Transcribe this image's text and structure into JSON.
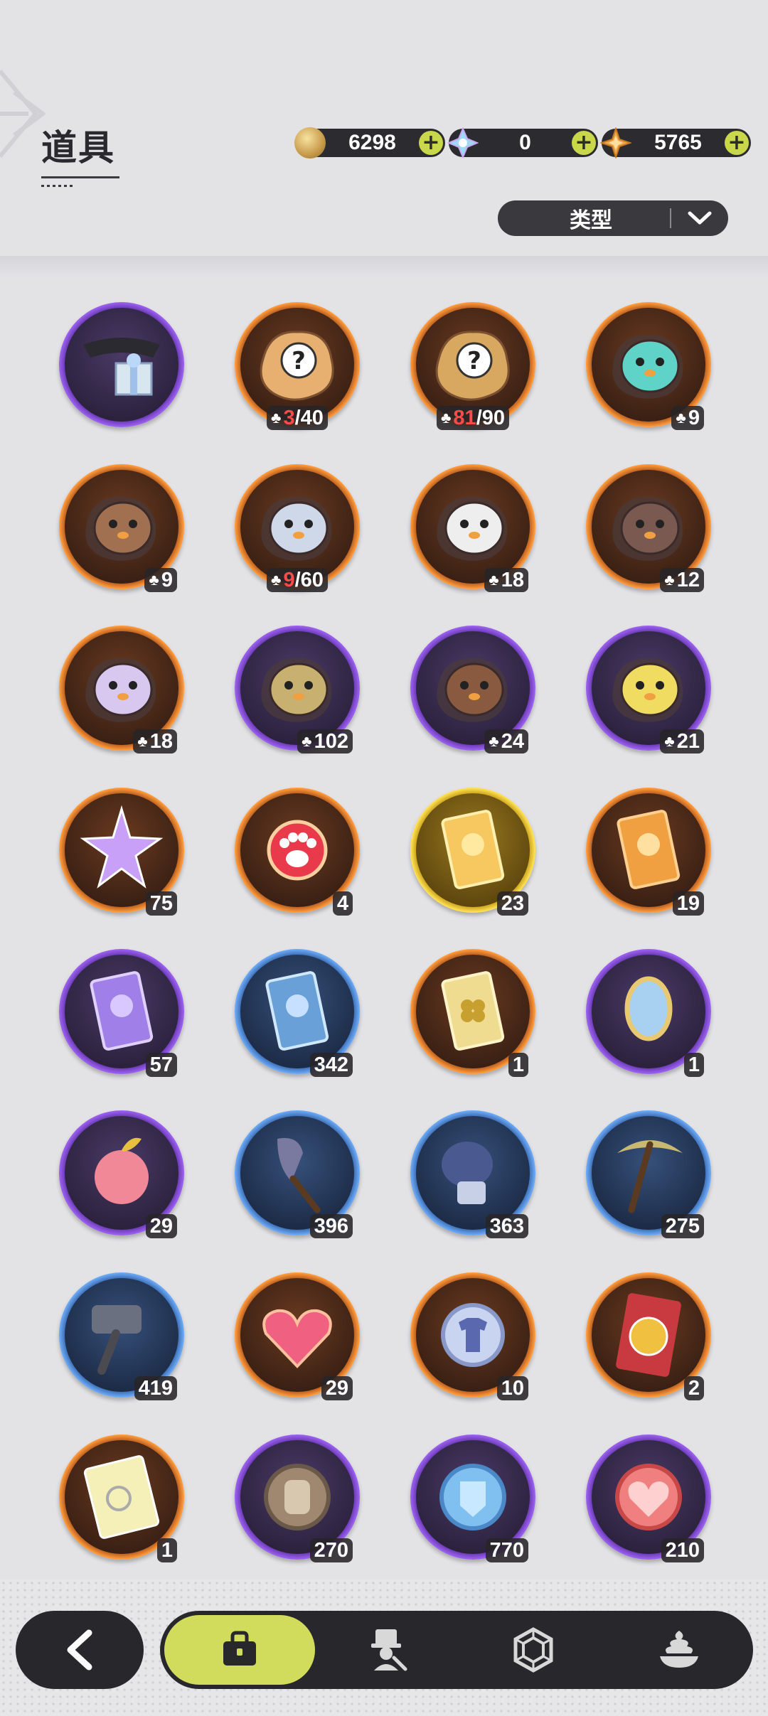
{
  "header": {
    "title": "道具"
  },
  "currencies": [
    {
      "icon": "gold-coin-icon",
      "value": "6298"
    },
    {
      "icon": "crystal-icon",
      "value": "0"
    },
    {
      "icon": "star-gem-icon",
      "value": "5765"
    }
  ],
  "filter": {
    "label": "类型",
    "icon": "chevron-down-icon"
  },
  "items": [
    {
      "name": "gift-box-item",
      "rarity": "purple",
      "count": ""
    },
    {
      "name": "random-fragment-orange",
      "rarity": "orange",
      "fragment": true,
      "have": "3",
      "need": "/40"
    },
    {
      "name": "random-fragment-gold",
      "rarity": "orange",
      "fragment": true,
      "have": "81",
      "need": "/90"
    },
    {
      "name": "teal-bird-fragment",
      "rarity": "orange",
      "fragment": true,
      "count": "9"
    },
    {
      "name": "bear-fragment",
      "rarity": "orange",
      "fragment": true,
      "count": "9"
    },
    {
      "name": "knight-fragment",
      "rarity": "orange",
      "fragment": true,
      "have": "9",
      "need": "/60"
    },
    {
      "name": "white-creature-fragment",
      "rarity": "orange",
      "fragment": true,
      "count": "18"
    },
    {
      "name": "dark-bear-fragment",
      "rarity": "orange",
      "fragment": true,
      "count": "12"
    },
    {
      "name": "lilac-creature-fragment",
      "rarity": "orange",
      "fragment": true,
      "count": "18"
    },
    {
      "name": "frog-fragment",
      "rarity": "purple",
      "fragment": true,
      "count": "102"
    },
    {
      "name": "brown-bear-fragment",
      "rarity": "purple",
      "fragment": true,
      "count": "24"
    },
    {
      "name": "yellow-chick-fragment",
      "rarity": "purple",
      "fragment": true,
      "count": "21"
    },
    {
      "name": "star-crystal",
      "rarity": "orange",
      "count": "75"
    },
    {
      "name": "paw-charm",
      "rarity": "orange",
      "count": "4"
    },
    {
      "name": "gold-card",
      "rarity": "gold",
      "count": "23"
    },
    {
      "name": "orange-card",
      "rarity": "orange",
      "count": "19"
    },
    {
      "name": "purple-card",
      "rarity": "purple",
      "count": "57"
    },
    {
      "name": "blue-card",
      "rarity": "blue",
      "count": "342"
    },
    {
      "name": "clover-card",
      "rarity": "orange",
      "count": "1"
    },
    {
      "name": "magic-mirror",
      "rarity": "purple",
      "count": "1"
    },
    {
      "name": "pink-apple",
      "rarity": "purple",
      "count": "29"
    },
    {
      "name": "shovel",
      "rarity": "blue",
      "count": "396"
    },
    {
      "name": "gauntlet",
      "rarity": "blue",
      "count": "363"
    },
    {
      "name": "pickaxe",
      "rarity": "blue",
      "count": "275"
    },
    {
      "name": "hammer",
      "rarity": "blue",
      "count": "419"
    },
    {
      "name": "ruby-heart",
      "rarity": "orange",
      "count": "29"
    },
    {
      "name": "shirt-coin",
      "rarity": "orange",
      "count": "10"
    },
    {
      "name": "wheel-ticket",
      "rarity": "orange",
      "count": "2"
    },
    {
      "name": "rainbow-ticket",
      "rarity": "orange",
      "count": "1"
    },
    {
      "name": "fist-coin",
      "rarity": "purple",
      "count": "270"
    },
    {
      "name": "blue-emblem-coin",
      "rarity": "purple",
      "count": "770"
    },
    {
      "name": "heart-coin",
      "rarity": "purple",
      "count": "210"
    }
  ],
  "bottom_nav": {
    "back_icon": "back-arrow-icon",
    "tabs": [
      {
        "icon": "bag-icon",
        "active": true
      },
      {
        "icon": "character-icon",
        "active": false
      },
      {
        "icon": "hexagon-gem-icon",
        "active": false
      },
      {
        "icon": "dessert-icon",
        "active": false
      }
    ]
  },
  "colors": {
    "purple": "#8a4ee0",
    "orange": "#ff8a2a",
    "gold": "#f3cc2c",
    "blue": "#4a8ee8",
    "accent": "#d2dc5c"
  }
}
